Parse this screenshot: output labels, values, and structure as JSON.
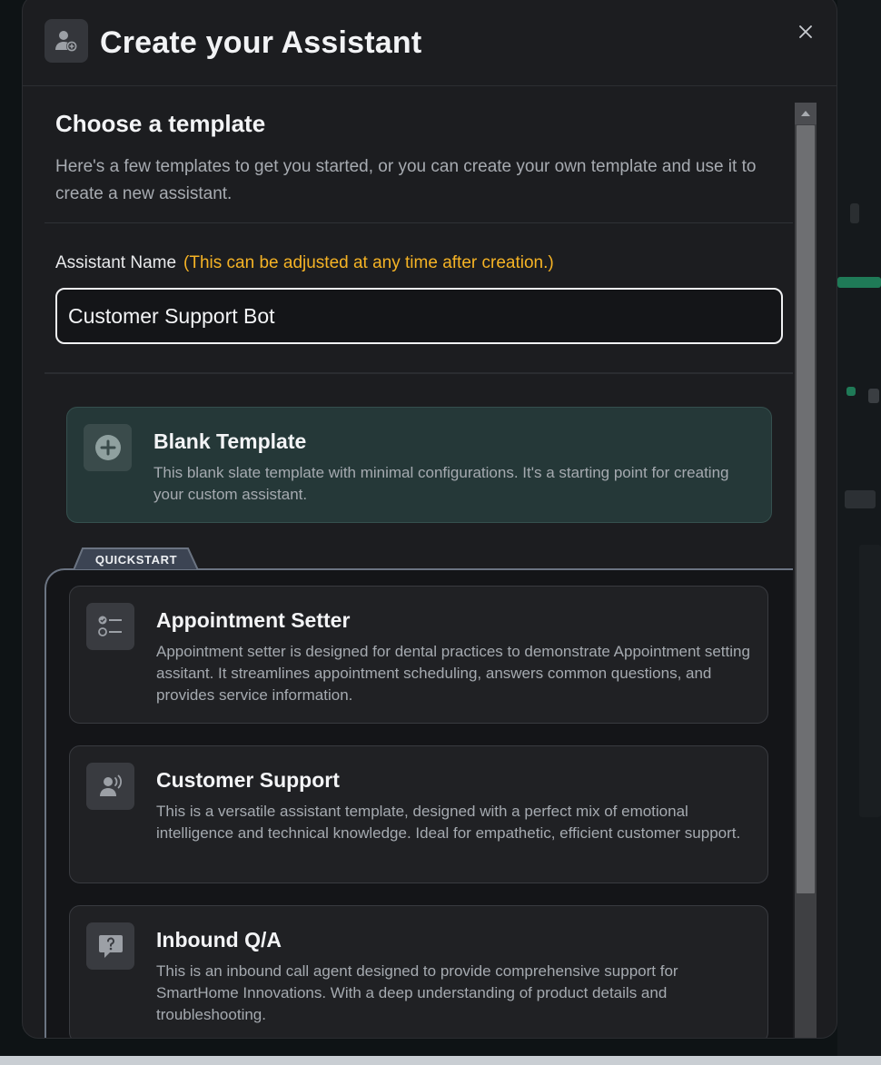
{
  "modal": {
    "title": "Create your Assistant",
    "close_label": "close"
  },
  "template_section": {
    "title": "Choose a template",
    "description": "Here's a few templates to get you started, or you can create your own template and use it to create a new assistant."
  },
  "assistant_name": {
    "label": "Assistant Name",
    "hint": "(This can be adjusted at any time after creation.)",
    "value": "Customer Support Bot"
  },
  "blank_template": {
    "title": "Blank Template",
    "description": "This blank slate template with minimal configurations. It's a starting point for creating your custom assistant.",
    "icon": "plus-circle-icon"
  },
  "quickstart": {
    "tab_label": "QUICKSTART",
    "templates": [
      {
        "title": "Appointment Setter",
        "description": "Appointment setter is designed for dental practices to demonstrate Appointment setting assitant. It streamlines appointment scheduling, answers common questions, and provides service information.",
        "icon": "checklist-icon"
      },
      {
        "title": "Customer Support",
        "description": "This is a versatile assistant template, designed with a perfect mix of emotional intelligence and technical knowledge. Ideal for empathetic, efficient customer support.",
        "icon": "person-voice-icon"
      },
      {
        "title": "Inbound Q/A",
        "description": "This is an inbound call agent designed to provide comprehensive support for SmartHome Innovations. With a deep understanding of product details and troubleshooting.",
        "icon": "question-bubble-icon"
      }
    ]
  },
  "colors": {
    "modal_bg": "#1c1d20",
    "hint": "#f5b325",
    "blank_card_bg": "#253838",
    "quickstart_border": "#6b7482"
  }
}
